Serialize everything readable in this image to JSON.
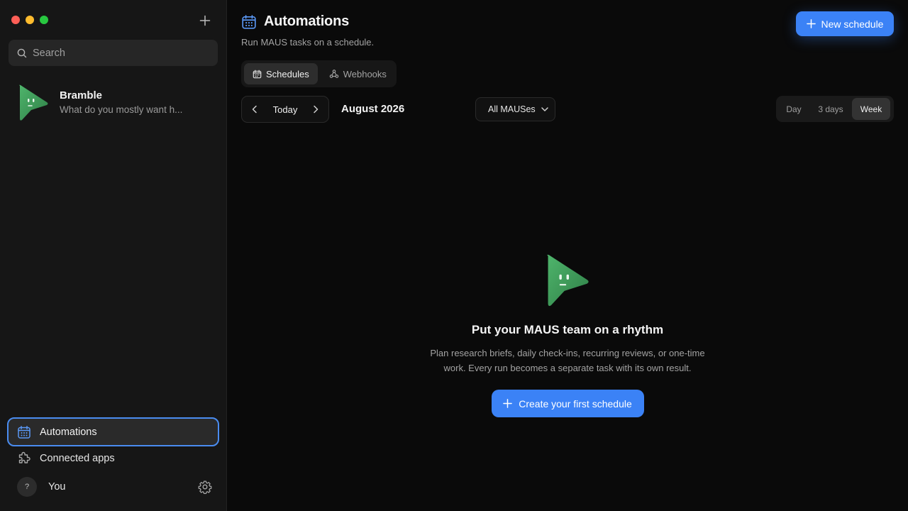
{
  "colors": {
    "accent": "#3b82f6",
    "traffic_close": "#ff5f57",
    "traffic_minimize": "#febc2e",
    "traffic_zoom": "#28c840",
    "brand_green": "#3f9a5a"
  },
  "sidebar": {
    "search": {
      "placeholder": "Search",
      "icon": "search-icon"
    },
    "agent": {
      "name": "Bramble",
      "preview": "What do you mostly want h..."
    },
    "nav": {
      "automations": {
        "label": "Automations",
        "icon": "calendar-icon",
        "active": true
      },
      "connected_apps": {
        "label": "Connected apps",
        "icon": "puzzle-icon"
      }
    },
    "user": {
      "avatar_text": "?",
      "name": "You"
    }
  },
  "main": {
    "title": "Automations",
    "subtitle": "Run MAUS tasks on a schedule.",
    "new_schedule_label": "New schedule",
    "tabs": [
      {
        "label": "Schedules",
        "icon": "calendar-icon",
        "active": true
      },
      {
        "label": "Webhooks",
        "icon": "webhook-icon",
        "active": false
      }
    ],
    "today_label": "Today",
    "month_label": "August 2026",
    "filter": {
      "selected": "All MAUSes"
    },
    "views": [
      {
        "label": "Day",
        "active": false
      },
      {
        "label": "3 days",
        "active": false
      },
      {
        "label": "Week",
        "active": true
      }
    ],
    "empty": {
      "title": "Put your MAUS team on a rhythm",
      "description": "Plan research briefs, daily check-ins, recurring reviews, or one-time work. Every run becomes a separate task with its own result.",
      "cta": "Create your first schedule"
    }
  }
}
